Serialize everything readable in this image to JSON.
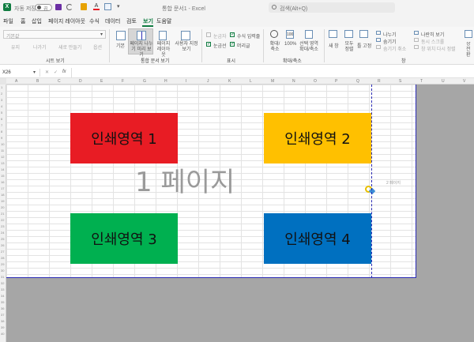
{
  "titlebar": {
    "autosave_label": "자동 저장",
    "autosave_state": "끔",
    "document_title": "통합 문서1 - Excel",
    "search_placeholder": "검색(Alt+Q)"
  },
  "menu": {
    "tabs": [
      "파일",
      "홈",
      "삽입",
      "페이지 레이아웃",
      "수식",
      "데이터",
      "검토",
      "보기",
      "도움말"
    ],
    "active_tab": "보기"
  },
  "ribbon": {
    "sheet_view": {
      "dropdown_value": "기본값",
      "buttons": [
        "유지",
        "나가기",
        "새로 만들기",
        "옵션"
      ],
      "group_label": "시트 보기"
    },
    "workbook_views": {
      "buttons": [
        "기본",
        "페이지 나누기 미리 보기",
        "페이지 레이아웃",
        "사용자 지정 보기"
      ],
      "group_label": "통합 문서 보기"
    },
    "show": {
      "checks": [
        "눈금자",
        "수식 입력줄",
        "눈금선",
        "머리글"
      ],
      "group_label": "표시"
    },
    "zoom": {
      "buttons": [
        "확대/축소",
        "100%",
        "선택 영역 확대/축소"
      ],
      "group_label": "확대/축소"
    },
    "window": {
      "buttons": [
        "새 창",
        "모두 정렬",
        "틀 고정",
        "나누기",
        "숨기기",
        "숨기기 취소",
        "나란히 보기",
        "동시 스크롤",
        "창 위치 다시 정렬",
        "창 전환"
      ],
      "group_label": "창"
    }
  },
  "formula_bar": {
    "name_box": "X26",
    "fx": "fx",
    "value": ""
  },
  "grid": {
    "columns": [
      "A",
      "B",
      "C",
      "D",
      "E",
      "F",
      "G",
      "H",
      "I",
      "J",
      "K",
      "L",
      "M",
      "N",
      "O",
      "P",
      "Q",
      "R",
      "S",
      "T",
      "U",
      "V"
    ],
    "rows": [
      "1",
      "2",
      "3",
      "4",
      "5",
      "6",
      "7",
      "8",
      "9",
      "10",
      "11",
      "12",
      "13",
      "14",
      "15",
      "16",
      "17",
      "18",
      "19",
      "20",
      "21",
      "22",
      "23",
      "24",
      "25",
      "26",
      "27",
      "28",
      "29",
      "30",
      "31",
      "32",
      "33",
      "34",
      "35",
      "36",
      "37",
      "38",
      "39",
      "40"
    ]
  },
  "print_areas": [
    {
      "label": "인쇄영역 1",
      "color": "#e81c24"
    },
    {
      "label": "인쇄영역 2",
      "color": "#ffc000"
    },
    {
      "label": "인쇄영역 3",
      "color": "#00b050"
    },
    {
      "label": "인쇄영역 4",
      "color": "#0070c0"
    }
  ],
  "page_watermark": "1 페이지",
  "side_page_label": "2 페이지",
  "colors": {
    "accent": "#107c41",
    "page_border": "#2b2bb5",
    "outside_area": "#a6a6a6"
  }
}
